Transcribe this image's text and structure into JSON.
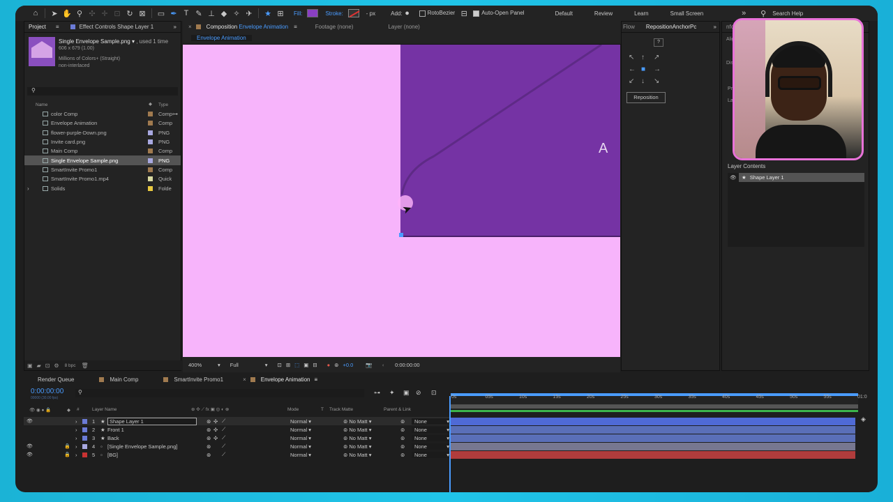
{
  "toolbar": {
    "fill_label": "Fill:",
    "stroke_label": "Stroke:",
    "px_label": "- px",
    "add_label": "Add:",
    "rotobezier_label": "RotoBezier",
    "auto_open_label": "Auto-Open Panel",
    "workspaces": [
      "Default",
      "Review",
      "Learn",
      "Small Screen"
    ],
    "search_label": "Search Help",
    "fill_color": "#8a3fc2"
  },
  "project": {
    "tabs": {
      "project": "Project",
      "effect_controls": "Effect Controls Shape Layer 1"
    },
    "selected_name": "Single Envelope Sample.png",
    "used_text": ", used 1 time",
    "dims": "606 x 679 (1.00)",
    "colors": "Millions of Colors+ (Straight)",
    "interlace": "non-interlaced",
    "col_name": "Name",
    "col_type": "Type",
    "items": [
      {
        "name": "color Comp",
        "type": "Comp",
        "color": "#a07a4f"
      },
      {
        "name": "Envelope Animation",
        "type": "Comp",
        "color": "#a07a4f"
      },
      {
        "name": "flower-purple-Down.png",
        "type": "PNG",
        "color": "#a8a8e0"
      },
      {
        "name": "Invite card.png",
        "type": "PNG",
        "color": "#a8a8e0"
      },
      {
        "name": "Main Comp",
        "type": "Comp",
        "color": "#a07a4f"
      },
      {
        "name": "Single Envelope Sample.png",
        "type": "PNG",
        "color": "#a8a8e0"
      },
      {
        "name": "SmartInvite Promo1",
        "type": "Comp",
        "color": "#a07a4f"
      },
      {
        "name": "SmartInvite Promo1.mp4",
        "type": "Quick",
        "color": "#d8d8a0"
      },
      {
        "name": "Solids",
        "type": "Folde",
        "color": "#e8c840"
      }
    ],
    "bpc": "8 bpc"
  },
  "composition": {
    "tab_prefix": "Composition",
    "tab_name": "Envelope Animation",
    "footage": "Footage (none)",
    "layer": "Layer (none)",
    "breadcrumb": "Envelope Animation",
    "zoom": "400%",
    "resolution": "Full",
    "exposure": "+0.0",
    "timecode": "0:00:00:00",
    "canvas_text": "A N"
  },
  "right_panel": {
    "flow_tab": "Flow",
    "anchor_tab": "RepositionAnchorPc",
    "info_tab": "nfo",
    "reposition_btn": "Reposition",
    "layer_contents_label": "Layer Contents",
    "layer_contents_item": "Shape Layer 1",
    "side_labels": [
      "Alig",
      "Dis",
      "Pr",
      "La"
    ]
  },
  "timeline": {
    "tabs": [
      {
        "label": "Render Queue",
        "color": ""
      },
      {
        "label": "Main Comp",
        "color": "#a07a4f"
      },
      {
        "label": "SmartInvite Promo1",
        "color": "#a07a4f"
      },
      {
        "label": "Envelope Animation",
        "color": ""
      }
    ],
    "timecode": "0:00:00:00",
    "sub_timecode": "00000 (30.00 fps)",
    "headers": {
      "layer_name": "Layer Name",
      "mode": "Mode",
      "t": "T",
      "track_matte": "Track Matte",
      "parent": "Parent & Link"
    },
    "layers": [
      {
        "num": "1",
        "name": "Shape Layer 1",
        "mode": "Normal",
        "matte": "No Matt",
        "parent": "None",
        "color": "#6b7bd6",
        "star": "★",
        "bar": "#4f6ad6"
      },
      {
        "num": "2",
        "name": "Front 1",
        "mode": "Normal",
        "matte": "No Matt",
        "parent": "None",
        "color": "#6b7bd6",
        "star": "★",
        "bar": "#5a6fb8"
      },
      {
        "num": "3",
        "name": "Back",
        "mode": "Normal",
        "matte": "No Matt",
        "parent": "None",
        "color": "#6b7bd6",
        "star": "★",
        "bar": "#5a6fb8"
      },
      {
        "num": "4",
        "name": "[Single Envelope Sample.png]",
        "mode": "Normal",
        "matte": "No Matt",
        "parent": "None",
        "color": "#a8a8e0",
        "star": "",
        "bar": "#777790"
      },
      {
        "num": "5",
        "name": "[BG]",
        "mode": "Normal",
        "matte": "No Matt",
        "parent": "None",
        "color": "#c83232",
        "star": "",
        "bar": "#b03c3c"
      }
    ],
    "ruler": [
      "0s",
      "05s",
      "10s",
      "15s",
      "20s",
      "25s",
      "30s",
      "35s",
      "40s",
      "45s",
      "50s",
      "55s",
      "01:0"
    ]
  }
}
